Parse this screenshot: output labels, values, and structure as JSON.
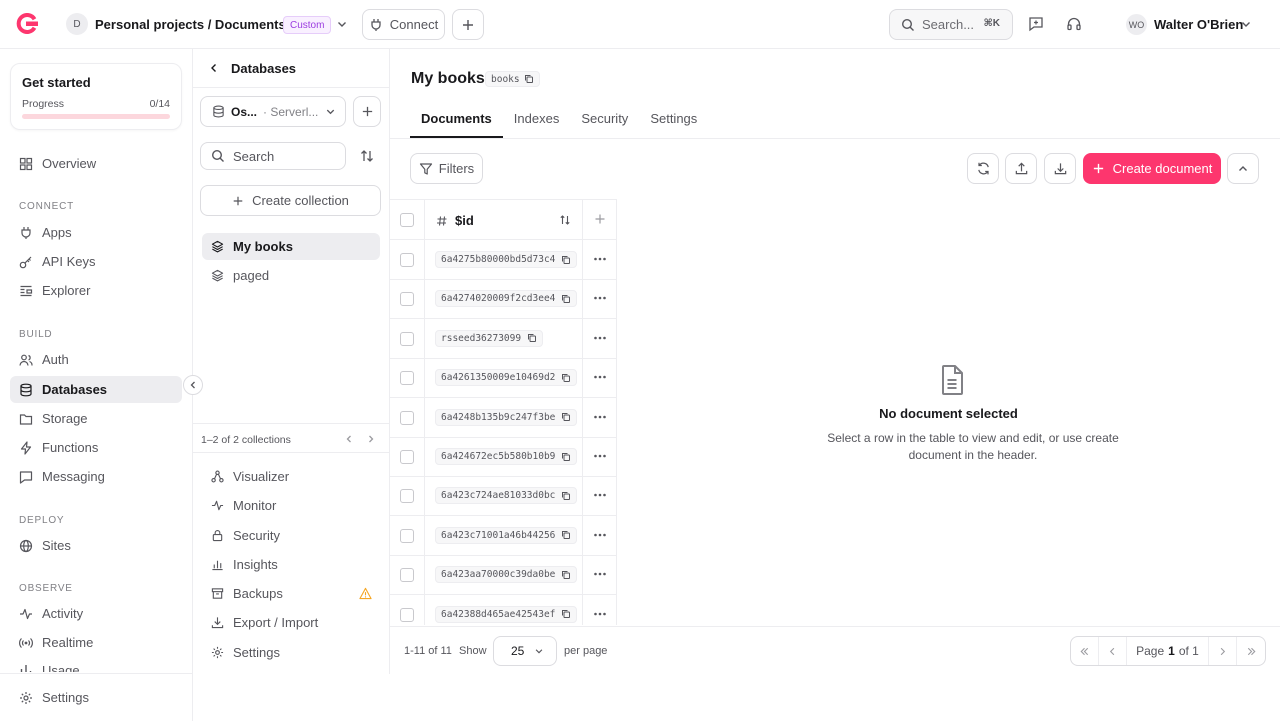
{
  "topbar": {
    "org_initial": "D",
    "org_title": "Personal projects / DocumentsDB",
    "plan_badge": "Custom",
    "connect_label": "Connect",
    "search_placeholder": "Search...",
    "search_shortcut": "⌘K",
    "user_initials": "WO",
    "user_name": "Walter O'Brien"
  },
  "sidebar": {
    "get_started": {
      "title": "Get started",
      "progress_label": "Progress",
      "progress_value": "0/14",
      "progress_fraction": 0
    },
    "overview": "Overview",
    "sections": {
      "connect": "CONNECT",
      "build": "BUILD",
      "deploy": "DEPLOY",
      "observe": "OBSERVE"
    },
    "items": {
      "apps": "Apps",
      "api_keys": "API Keys",
      "explorer": "Explorer",
      "auth": "Auth",
      "databases": "Databases",
      "storage": "Storage",
      "functions": "Functions",
      "messaging": "Messaging",
      "sites": "Sites",
      "activity": "Activity",
      "realtime": "Realtime",
      "usage": "Usage"
    },
    "settings": "Settings"
  },
  "dbpanel": {
    "title": "Databases",
    "db_name": "Os...",
    "db_type": "· Serverl...",
    "search_placeholder": "Search",
    "create_collection": "Create collection",
    "collections": [
      "My books",
      "paged"
    ],
    "count_label": "1–2 of 2 collections",
    "links": {
      "visualizer": "Visualizer",
      "monitor": "Monitor",
      "security": "Security",
      "insights": "Insights",
      "backups": "Backups",
      "export_import": "Export / Import",
      "settings": "Settings"
    }
  },
  "main": {
    "title": "My books",
    "collection_id": "books",
    "tabs": [
      "Documents",
      "Indexes",
      "Security",
      "Settings"
    ],
    "filters_label": "Filters",
    "create_document": "Create document",
    "column_id": "$id",
    "rows": [
      "6a4275b80000bd5d73c4",
      "6a4274020009f2cd3ee4",
      "rsseed36273099",
      "6a4261350009e10469d2",
      "6a4248b135b9c247f3be",
      "6a424672ec5b580b10b9",
      "6a423c724ae81033d0bc",
      "6a423c71001a46b44256",
      "6a423aa70000c39da0be",
      "6a42388d465ae42543ef"
    ],
    "empty_title": "No document selected",
    "empty_text": "Select a row in the table to view and edit, or use create document in the header.",
    "footer": {
      "count": "1-11 of 11",
      "show": "Show",
      "per_page_value": "25",
      "per_page": "per page",
      "page_label": "Page",
      "page_current": "1",
      "page_total": "of 1"
    }
  }
}
